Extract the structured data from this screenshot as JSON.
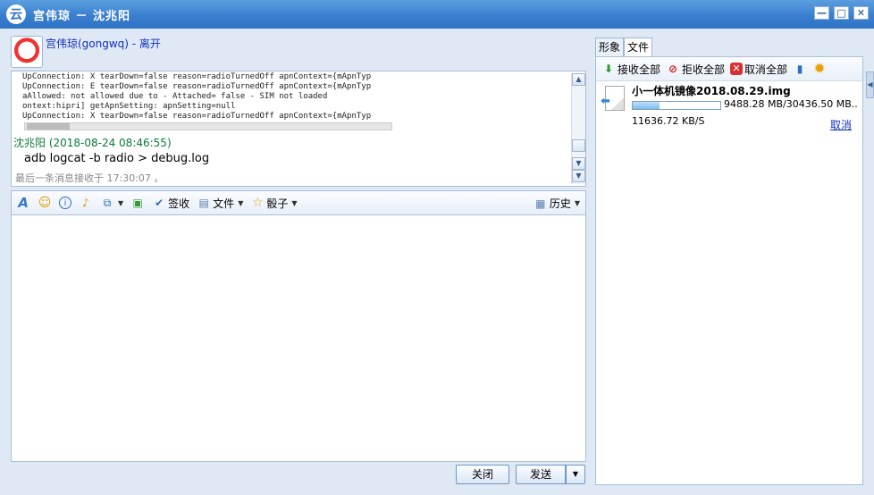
{
  "window": {
    "title": "宫伟琼 － 沈兆阳",
    "logo": "云",
    "min": "—",
    "max": "□",
    "close": "✕"
  },
  "contact": {
    "name": "宫伟琼(gongwq) - 离开"
  },
  "messages": {
    "log_lines": [
      "UpConnection: X tearDown=false reason=radioTurnedOff apnContext={mApnTyp",
      "UpConnection: E tearDown=false reason=radioTurnedOff apnContext={mApnTyp",
      "aAllowed: not allowed due to - Attached= false - SIM not loaded",
      "ontext:hipri] getApnSetting: apnSetting=null",
      "UpConnection: X tearDown=false reason=radioTurnedOff apnContext={mApnTyp"
    ],
    "sender": "沈兆阳 (2018-08-24 08:46:55)",
    "command": "adb logcat -b radio > debug.log",
    "last_received": "最后一条消息接收于 17:30:07 。"
  },
  "toolbar": {
    "sign_label": "签收",
    "file_label": "文件",
    "dice_label": "骰子",
    "history_label": "历史"
  },
  "actions": {
    "close_label": "关闭",
    "send_label": "发送"
  },
  "right_tabs": [
    "形象",
    "文件"
  ],
  "transfer_toolbar": {
    "accept_all": "接收全部",
    "reject_all": "拒收全部",
    "cancel_all": "取消全部"
  },
  "transfer": {
    "file_name": "小一体机镜像2018.08.29.img",
    "size_progress": "9488.28 MB/30436.50 MB...",
    "speed": "11636.72 KB/S",
    "cancel_label": "取消",
    "progress_fraction": 0.31
  },
  "colors": {
    "title_bar": "#3a7fcf",
    "link": "#1030c0",
    "sender": "#0a7a3a"
  }
}
